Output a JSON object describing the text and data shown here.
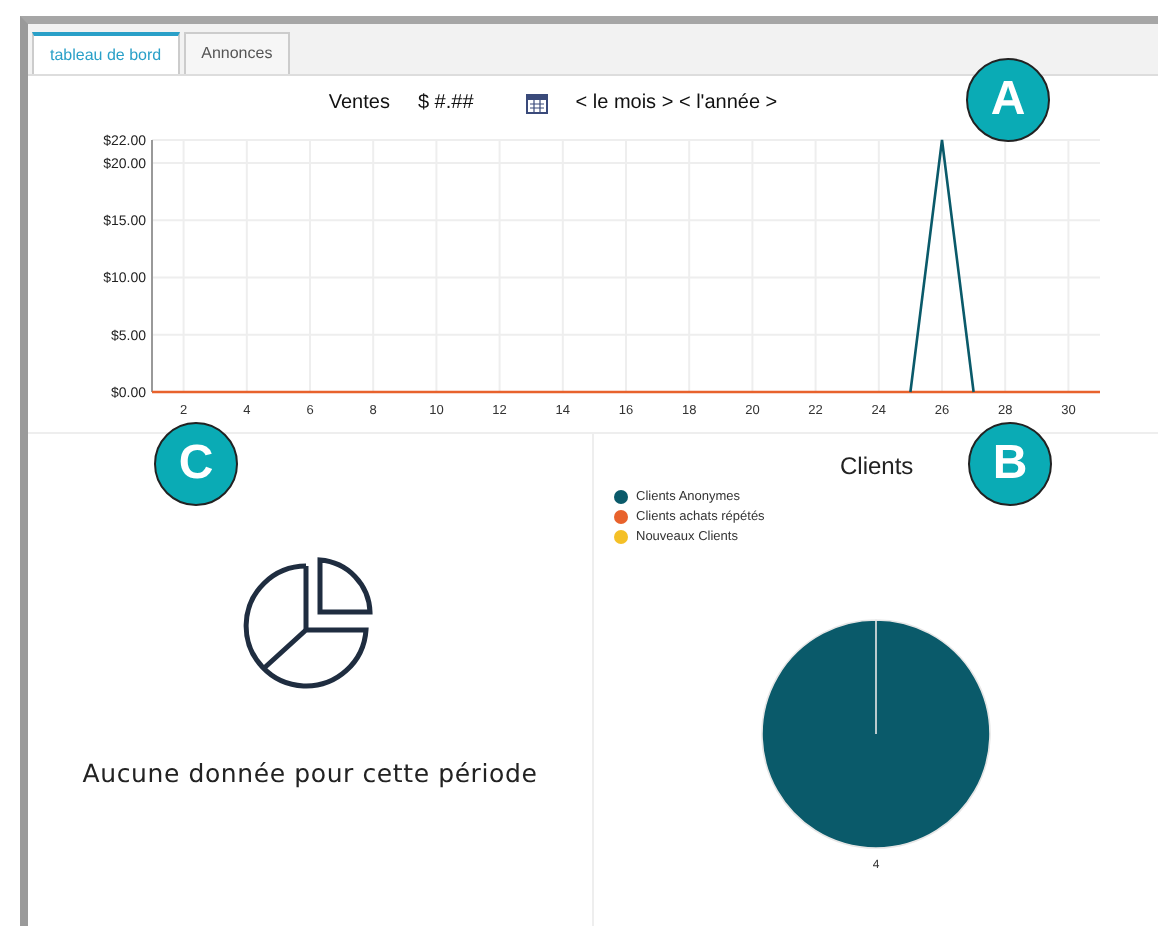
{
  "tabs": [
    {
      "label": "tableau de bord",
      "selected": true
    },
    {
      "label": "Annonces",
      "selected": false
    }
  ],
  "sales_header": {
    "label": "Ventes",
    "amount": "$ #.##",
    "period": "< le mois > < l'année >"
  },
  "sales_chart": {
    "chart_data": {
      "type": "line",
      "grid": true,
      "x": [
        1,
        2,
        3,
        4,
        5,
        6,
        7,
        8,
        9,
        10,
        11,
        12,
        13,
        14,
        15,
        16,
        17,
        18,
        19,
        20,
        21,
        22,
        23,
        24,
        25,
        26,
        27,
        28,
        29,
        30,
        31
      ],
      "xlim": [
        1,
        31
      ],
      "ylim": [
        0,
        22
      ],
      "xticks": [
        2,
        4,
        6,
        8,
        10,
        12,
        14,
        16,
        18,
        20,
        22,
        24,
        26,
        28,
        30
      ],
      "yticks": [
        {
          "value": 0,
          "label": "$0.00"
        },
        {
          "value": 5,
          "label": "$5.00"
        },
        {
          "value": 10,
          "label": "$10.00"
        },
        {
          "value": 15,
          "label": "$15.00"
        },
        {
          "value": 20,
          "label": "$20.00"
        },
        {
          "value": 22,
          "label": "$22.00"
        }
      ],
      "series": [
        {
          "color": "#e8622c",
          "values": [
            0,
            0,
            0,
            0,
            0,
            0,
            0,
            0,
            0,
            0,
            0,
            0,
            0,
            0,
            0,
            0,
            0,
            0,
            0,
            0,
            0,
            0,
            0,
            0,
            0,
            0,
            0,
            0,
            0,
            0,
            0
          ]
        },
        {
          "color": "#0a5a6a",
          "values": [
            null,
            null,
            null,
            null,
            null,
            null,
            null,
            null,
            null,
            null,
            null,
            null,
            null,
            null,
            null,
            null,
            null,
            null,
            null,
            null,
            null,
            null,
            null,
            null,
            0,
            22,
            0,
            null,
            null,
            null,
            null
          ]
        }
      ]
    }
  },
  "empty_panel": {
    "message": "Aucune donnée pour cette période"
  },
  "clients_chart": {
    "chart_data": {
      "type": "pie",
      "title": "Clients",
      "categories": [
        "Clients Anonymes",
        "Clients achats répétés",
        "Nouveaux Clients"
      ],
      "values": [
        4,
        0,
        0
      ],
      "colors": [
        "#0a5a6a",
        "#e8622c",
        "#f4c027"
      ],
      "data_labels": true
    }
  },
  "callouts": [
    "A",
    "B",
    "C"
  ]
}
